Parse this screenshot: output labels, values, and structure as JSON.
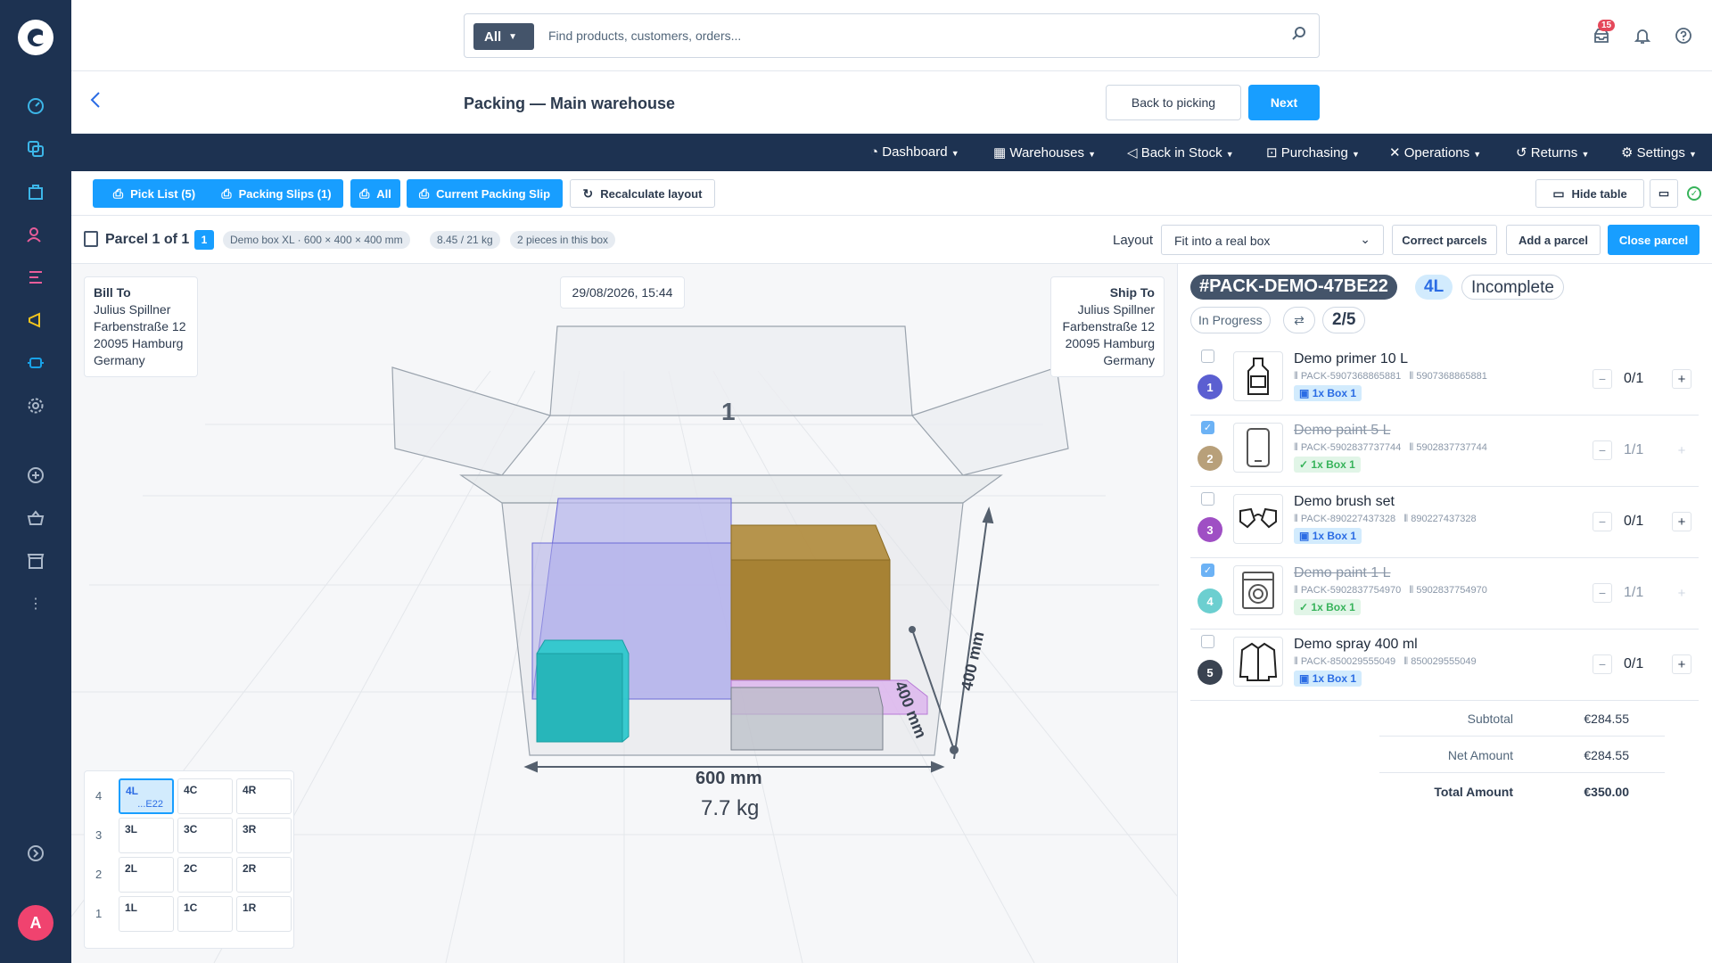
{
  "topbar": {
    "search_scope": "All",
    "search_placeholder": "Find products, customers, orders...",
    "notifications_count": "15"
  },
  "page": {
    "title": "Packing — Main warehouse",
    "back_to_picking": "Back to picking",
    "next": "Next"
  },
  "nav": [
    "Dashboard",
    "Warehouses",
    "Back in Stock",
    "Purchasing",
    "Operations",
    "Returns",
    "Settings"
  ],
  "toolbar": {
    "pick_list": "Pick List (5)",
    "packing_slips": "Packing Slips (1)",
    "all": "All",
    "current_slip": "Current Packing Slip",
    "recalc": "Recalculate layout",
    "hide_table": "Hide table"
  },
  "parcel": {
    "title": "Parcel 1 of 1",
    "number": "1",
    "box": "Demo box XL · 600 × 400 × 400 mm",
    "weight": "8.45 / 21 kg",
    "pieces": "2 pieces in this box",
    "layout_label": "Layout",
    "layout_value": "Fit into a real box",
    "correct": "Correct parcels",
    "add": "Add a parcel",
    "close": "Close parcel"
  },
  "viewer": {
    "bill_to": {
      "heading": "Bill To",
      "name": "Julius Spillner",
      "street": "Farbenstraße 12",
      "city": "20095 Hamburg",
      "country": "Germany"
    },
    "ship_to": {
      "heading": "Ship To",
      "name": "Julius Spillner",
      "street": "Farbenstraße 12",
      "city": "20095 Hamburg",
      "country": "Germany"
    },
    "date": "29/08/2026, 15:44",
    "box_number": "1",
    "width_label": "600 mm",
    "depth_label": "400 mm",
    "height_label": "400 mm",
    "weight_label": "7.7 kg",
    "slots": [
      {
        "row": "4",
        "cells": [
          "4L",
          "4C",
          "4R"
        ],
        "selected_sub": "...E22"
      },
      {
        "row": "3",
        "cells": [
          "3L",
          "3C",
          "3R"
        ]
      },
      {
        "row": "2",
        "cells": [
          "2L",
          "2C",
          "2R"
        ]
      },
      {
        "row": "1",
        "cells": [
          "1L",
          "1C",
          "1R"
        ]
      }
    ]
  },
  "order": {
    "id": "#PACK-DEMO-47BE22",
    "slot": "4L",
    "status": "Incomplete",
    "progress_status": "In Progress",
    "count": "2/5",
    "items": [
      {
        "n": "1",
        "name": "Demo primer 10 L",
        "sku": "PACK-5907368865881",
        "ean": "5907368865881",
        "tag": "1x Box 1",
        "qty": "0/1",
        "done": false,
        "color": "#5b5fd1"
      },
      {
        "n": "2",
        "name": "Demo paint 5 L",
        "sku": "PACK-5902837737744",
        "ean": "5902837737744",
        "tag": "1x Box 1",
        "qty": "1/1",
        "done": true,
        "color": "#b8a07a"
      },
      {
        "n": "3",
        "name": "Demo brush set",
        "sku": "PACK-890227437328",
        "ean": "890227437328",
        "tag": "1x Box 1",
        "qty": "0/1",
        "done": false,
        "color": "#9f4fc4"
      },
      {
        "n": "4",
        "name": "Demo paint 1 L",
        "sku": "PACK-5902837754970",
        "ean": "5902837754970",
        "tag": "1x Box 1",
        "qty": "1/1",
        "done": true,
        "color": "#6ccfd0"
      },
      {
        "n": "5",
        "name": "Demo spray 400 ml",
        "sku": "PACK-850029555049",
        "ean": "850029555049",
        "tag": "1x Box 1",
        "qty": "0/1",
        "done": false,
        "color": "#3a4351"
      }
    ],
    "totals": {
      "subtotal_label": "Subtotal",
      "subtotal": "€284.55",
      "net_label": "Net Amount",
      "net": "€284.55",
      "total_label": "Total Amount",
      "total": "€350.00"
    }
  }
}
